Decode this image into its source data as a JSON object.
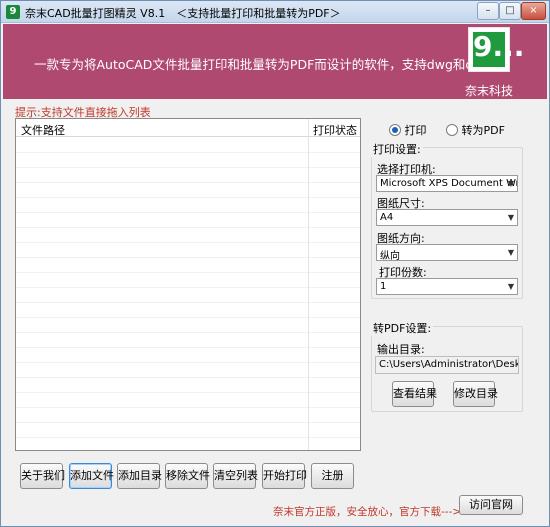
{
  "window": {
    "title": "奈末CAD批量打图精灵 V8.1　＜支持批量打印和批量转为PDF＞",
    "icon": "app-logo-icon",
    "controls": {
      "minimize": "–",
      "maximize": "□",
      "close": "×"
    }
  },
  "banner": {
    "text": "一款专为将AutoCAD文件批量打印和批量转为PDF而设计的软件，支持dwg和dxf",
    "logo_glyph": "9...",
    "brand": "奈末科技",
    "color": "#b0496f"
  },
  "file_list": {
    "hint": "提示:支持文件直接拖入列表",
    "columns": [
      "文件路径",
      "打印状态"
    ],
    "rows": []
  },
  "mode": {
    "options": [
      {
        "label": "打印",
        "selected": true
      },
      {
        "label": "转为PDF",
        "selected": false
      }
    ]
  },
  "print_settings": {
    "title": "打印设置:",
    "printer_label": "选择打印机:",
    "printer_value": "Microsoft XPS Document Writer",
    "paper_size_label": "图纸尺寸:",
    "paper_size_value": "A4",
    "orientation_label": "图纸方向:",
    "orientation_value": "纵向",
    "copies_label": "打印份数:",
    "copies_value": "1"
  },
  "pdf_settings": {
    "title": "转PDF设置:",
    "output_label": "输出目录:",
    "output_path": "C:\\Users\\Administrator\\Desktop",
    "view_result_label": "查看结果",
    "change_dir_label": "修改目录"
  },
  "bottom_buttons": {
    "about": "关于我们",
    "add_file": "添加文件",
    "add_dir": "添加目录",
    "remove_file": "移除文件",
    "clear_list": "清空列表",
    "start_print": "开始打印",
    "register": "注册",
    "visit_site": "访问官网"
  },
  "footer": {
    "note": "奈末官方正版，安全放心，官方下载--->>"
  },
  "colors": {
    "accent": "#b0496f",
    "hint_red": "#c0392b",
    "logo_green": "#1f9a3d"
  }
}
